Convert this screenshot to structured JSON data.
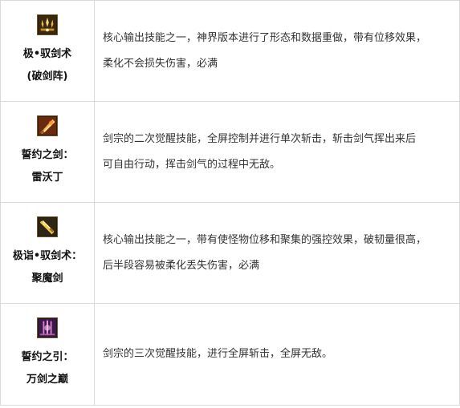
{
  "skills": [
    {
      "icon": "sword-formation-skill-icon",
      "name_lines": [
        "极•驭剑术",
        "(破剑阵)"
      ],
      "desc_lines": [
        "核心输出技能之一，神界版本进行了形态和数据重做，带有位移效果，",
        "柔化不会损失伤害，必满"
      ]
    },
    {
      "icon": "awakening-sword-skill-icon",
      "name_lines": [
        "誓约之剑：",
        "雷沃丁"
      ],
      "desc_lines": [
        "剑宗的二次觉醒技能，全屏控制并进行单次斩击，斩击剑气挥出来后",
        "可自由行动，挥击剑气的过程中无敌。"
      ]
    },
    {
      "icon": "gathering-sword-skill-icon",
      "name_lines": [
        "极诣•驭剑术：",
        "聚魔剑"
      ],
      "desc_lines": [
        "核心输出技能之一，带有使怪物位移和聚集的强控效果，破韧量很高，",
        "后半段容易被柔化丢失伤害，必满"
      ]
    },
    {
      "icon": "third-awakening-skill-icon",
      "name_lines": [
        "誓约之引：",
        "万剑之巅"
      ],
      "desc_lines": [
        "剑宗的三次觉醒技能，进行全屏斩击，全屏无敌。"
      ]
    }
  ]
}
